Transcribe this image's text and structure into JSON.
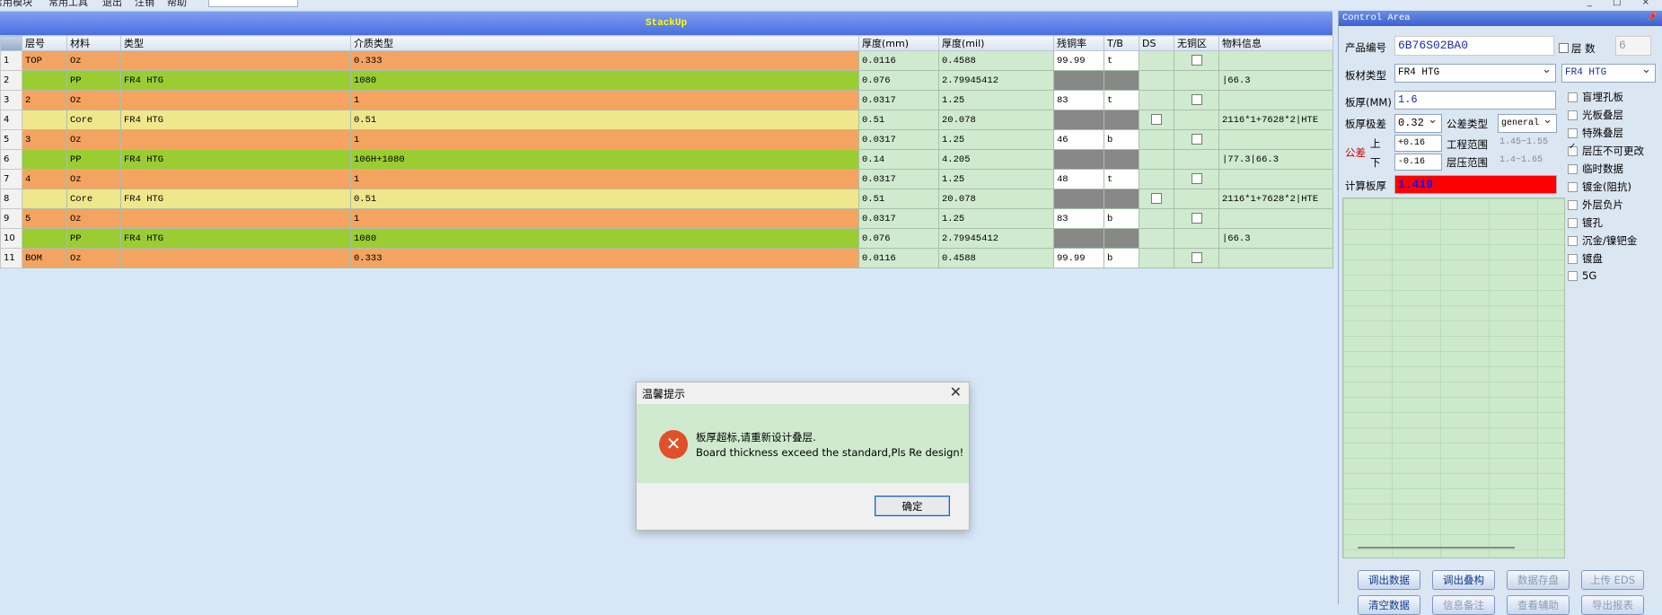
{
  "menu": {
    "items": [
      "常用模块",
      "常用工具",
      "退出",
      "注销",
      "帮助"
    ],
    "search_value": "",
    "window_controls": "_ □ ×"
  },
  "stackup": {
    "title": "StackUp",
    "columns": [
      "层号",
      "材料",
      "类型",
      "介质类型",
      "厚度(mm)",
      "厚度(mil)",
      "残铜率",
      "T/B",
      "DS",
      "无铜区",
      "物料信息"
    ],
    "rows": [
      {
        "num": "1",
        "layer": "TOP",
        "material": "Oz",
        "type": "",
        "dielectric": "0.333",
        "mm": "0.0116",
        "mil": "0.4588",
        "copper": "99.99",
        "tb": "t",
        "ds": "",
        "nocopper": "chk",
        "info": "",
        "kind": "copper"
      },
      {
        "num": "2",
        "layer": "",
        "material": "PP",
        "type": "FR4 HTG",
        "dielectric": "1080",
        "mm": "0.076",
        "mil": "2.79945412",
        "copper": "",
        "tb": "",
        "ds": "",
        "nocopper": "",
        "info": "|66.3",
        "kind": "pp"
      },
      {
        "num": "3",
        "layer": "2",
        "material": "Oz",
        "type": "",
        "dielectric": "1",
        "mm": "0.0317",
        "mil": "1.25",
        "copper": "83",
        "tb": "t",
        "ds": "",
        "nocopper": "chk",
        "info": "",
        "kind": "copper"
      },
      {
        "num": "4",
        "layer": "",
        "material": "Core",
        "type": "FR4 HTG",
        "dielectric": "0.51",
        "mm": "0.51",
        "mil": "20.078",
        "copper": "",
        "tb": "",
        "ds": "chk",
        "nocopper": "",
        "info": "2116*1+7628*2|HTE",
        "kind": "core"
      },
      {
        "num": "5",
        "layer": "3",
        "material": "Oz",
        "type": "",
        "dielectric": "1",
        "mm": "0.0317",
        "mil": "1.25",
        "copper": "46",
        "tb": "b",
        "ds": "",
        "nocopper": "chk",
        "info": "",
        "kind": "copper"
      },
      {
        "num": "6",
        "layer": "",
        "material": "PP",
        "type": "FR4 HTG",
        "dielectric": "106H+1080",
        "mm": "0.14",
        "mil": "4.205",
        "copper": "",
        "tb": "",
        "ds": "",
        "nocopper": "",
        "info": "|77.3|66.3",
        "kind": "pp"
      },
      {
        "num": "7",
        "layer": "4",
        "material": "Oz",
        "type": "",
        "dielectric": "1",
        "mm": "0.0317",
        "mil": "1.25",
        "copper": "48",
        "tb": "t",
        "ds": "",
        "nocopper": "chk",
        "info": "",
        "kind": "copper"
      },
      {
        "num": "8",
        "layer": "",
        "material": "Core",
        "type": "FR4 HTG",
        "dielectric": "0.51",
        "mm": "0.51",
        "mil": "20.078",
        "copper": "",
        "tb": "",
        "ds": "chk",
        "nocopper": "",
        "info": "2116*1+7628*2|HTE",
        "kind": "core"
      },
      {
        "num": "9",
        "layer": "5",
        "material": "Oz",
        "type": "",
        "dielectric": "1",
        "mm": "0.0317",
        "mil": "1.25",
        "copper": "83",
        "tb": "b",
        "ds": "",
        "nocopper": "chk",
        "info": "",
        "kind": "copper"
      },
      {
        "num": "10",
        "layer": "",
        "material": "PP",
        "type": "FR4 HTG",
        "dielectric": "1080",
        "mm": "0.076",
        "mil": "2.79945412",
        "copper": "",
        "tb": "",
        "ds": "",
        "nocopper": "",
        "info": "|66.3",
        "kind": "pp"
      },
      {
        "num": "11",
        "layer": "BOM",
        "material": "Oz",
        "type": "",
        "dielectric": "0.333",
        "mm": "0.0116",
        "mil": "0.4588",
        "copper": "99.99",
        "tb": "b",
        "ds": "",
        "nocopper": "chk",
        "info": "",
        "kind": "copper"
      }
    ]
  },
  "control": {
    "title": "Control Area",
    "product_label": "产品编号",
    "product_value": "6B76S02BA0",
    "layers_label": "层 数",
    "layers_value": "6",
    "material_label": "板材类型",
    "material_value": "FR4 HTG",
    "material_value2": "FR4 HTG",
    "thickness_label": "板厚(MM)",
    "thickness_value": "1.6",
    "tol_label": "板厚极差",
    "tol_value": "0.32",
    "tol_type_label": "公差类型",
    "tol_type_value": "general",
    "tolerance_label": "公差",
    "upper_label": "上",
    "lower_label": "下",
    "upper_value": "+0.16",
    "lower_value": "-0.16",
    "eng_range_label": "工程范围",
    "eng_range_value": "1.45~1.55",
    "press_range_label": "层压范围",
    "press_range_value": "1.4~1.65",
    "calc_label": "计算板厚",
    "calc_value": "1.419",
    "options": [
      {
        "label": "盲埋孔板",
        "checked": false
      },
      {
        "label": "光板叠层",
        "checked": false
      },
      {
        "label": "特殊叠层",
        "checked": false
      },
      {
        "label": "层压不可更改",
        "checked": true
      },
      {
        "label": "临时数据",
        "checked": false
      },
      {
        "label": "镀金(阻抗)",
        "checked": false
      },
      {
        "label": "外层负片",
        "checked": false
      },
      {
        "label": "镀孔",
        "checked": false
      },
      {
        "label": "沉金/镍钯金",
        "checked": false
      },
      {
        "label": "镀盘",
        "checked": false
      },
      {
        "label": "5G",
        "checked": false
      }
    ],
    "buttons": [
      "调出数据",
      "调出叠构",
      "数据存盘",
      "上传 EDS"
    ],
    "buttons_row2": [
      "清空数据",
      "信息备注",
      "查看辅助",
      "导出报表"
    ]
  },
  "dialog": {
    "title": "温馨提示",
    "message_cn": "板厚超标,请重新设计叠层.",
    "message_en": "Board thickness exceed the standard,Pls Re design!",
    "ok_label": "确定"
  },
  "colors": {
    "copper": "#f4a460",
    "pp": "#9acd32",
    "core": "#f0e68c",
    "calc_bg": "#ff0000",
    "calc_text": "#1010ff"
  }
}
